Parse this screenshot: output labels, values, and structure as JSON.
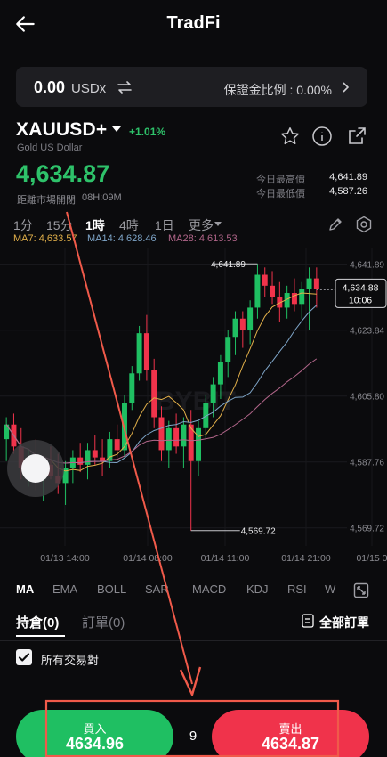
{
  "header": {
    "title": "TradFi"
  },
  "account": {
    "balance": "0.00",
    "unit": "USDx",
    "margin_label": "保證金比例 : 0.00%"
  },
  "symbol": {
    "name": "XAUUSD+",
    "change": "+1.01%",
    "subtitle": "Gold US Dollar",
    "price": "4,634.87",
    "status": "距離市場開閉",
    "countdown": "08H:09M",
    "high_label": "今日最高價",
    "high": "4,641.89",
    "low_label": "今日最低價",
    "low": "4,587.26"
  },
  "timeframes": [
    "1分",
    "15分",
    "1時",
    "4時",
    "1日",
    "更多"
  ],
  "ma_legend": [
    {
      "label": "MA7: 4,633.57",
      "color": "#e2b04a"
    },
    {
      "label": "MA14: 4,628.46",
      "color": "#7fa6c9"
    },
    {
      "label": "MA28: 4,613.53",
      "color": "#b2668a"
    }
  ],
  "chart_data": {
    "type": "candlestick",
    "y_ticks": [
      "4,641.89",
      "4,623.84",
      "4,605.80",
      "4,587.76",
      "4,569.72"
    ],
    "x_ticks": [
      "01/13 14:00",
      "01/14 08:00",
      "01/14 11:00",
      "01/14 21:00",
      "01/15 0"
    ],
    "ylim": [
      4566,
      4644
    ],
    "current_price": "4,634.88",
    "current_time": "10:06",
    "high_label": "4,641.89",
    "low_label": "4,569.72",
    "watermark": "BYBIT",
    "candles": [
      [
        4594,
        4600,
        4588,
        4598
      ],
      [
        4598,
        4601,
        4590,
        4592
      ],
      [
        4592,
        4597,
        4583,
        4586
      ],
      [
        4586,
        4591,
        4581,
        4589
      ],
      [
        4589,
        4594,
        4580,
        4583
      ],
      [
        4583,
        4589,
        4577,
        4587
      ],
      [
        4587,
        4592,
        4583,
        4584
      ],
      [
        4584,
        4590,
        4579,
        4582
      ],
      [
        4582,
        4588,
        4576,
        4586
      ],
      [
        4586,
        4591,
        4582,
        4589
      ],
      [
        4589,
        4593,
        4585,
        4587
      ],
      [
        4587,
        4593,
        4583,
        4591
      ],
      [
        4591,
        4595,
        4587,
        4589
      ],
      [
        4589,
        4594,
        4584,
        4588
      ],
      [
        4588,
        4596,
        4586,
        4594
      ],
      [
        4594,
        4598,
        4589,
        4591
      ],
      [
        4591,
        4606,
        4589,
        4604
      ],
      [
        4604,
        4614,
        4602,
        4612
      ],
      [
        4612,
        4625,
        4610,
        4623
      ],
      [
        4623,
        4628,
        4610,
        4613
      ],
      [
        4613,
        4616,
        4597,
        4600
      ],
      [
        4600,
        4603,
        4588,
        4591
      ],
      [
        4591,
        4599,
        4586,
        4597
      ],
      [
        4597,
        4601,
        4590,
        4592
      ],
      [
        4592,
        4600,
        4586,
        4598
      ],
      [
        4598,
        4602,
        4569,
        4588
      ],
      [
        4588,
        4599,
        4584,
        4597
      ],
      [
        4597,
        4606,
        4594,
        4604
      ],
      [
        4604,
        4611,
        4600,
        4609
      ],
      [
        4609,
        4617,
        4605,
        4615
      ],
      [
        4615,
        4624,
        4611,
        4622
      ],
      [
        4622,
        4629,
        4617,
        4627
      ],
      [
        4627,
        4629,
        4619,
        4624
      ],
      [
        4624,
        4632,
        4620,
        4630
      ],
      [
        4630,
        4642,
        4627,
        4639
      ],
      [
        4639,
        4641,
        4633,
        4636
      ],
      [
        4636,
        4640,
        4631,
        4633
      ],
      [
        4633,
        4637,
        4626,
        4630
      ],
      [
        4630,
        4636,
        4627,
        4634
      ],
      [
        4634,
        4638,
        4629,
        4631
      ],
      [
        4631,
        4637,
        4627,
        4635
      ],
      [
        4635,
        4641,
        4624,
        4638
      ],
      [
        4638,
        4641,
        4630,
        4635
      ]
    ]
  },
  "indicators": [
    "MA",
    "EMA",
    "BOLL",
    "SAR",
    "MACD",
    "KDJ",
    "RSI",
    "W"
  ],
  "tabs": {
    "positions": "持倉(0)",
    "orders": "訂單(0)",
    "all_orders": "全部訂單"
  },
  "filter": {
    "all_pairs": "所有交易對"
  },
  "trade": {
    "buy_label": "買入",
    "buy_price": "4634.96",
    "sell_label": "賣出",
    "sell_price": "4634.87",
    "lot": "9"
  },
  "colors": {
    "up": "#1fbf62",
    "down": "#f0334b",
    "annotation": "#f05a4a"
  }
}
